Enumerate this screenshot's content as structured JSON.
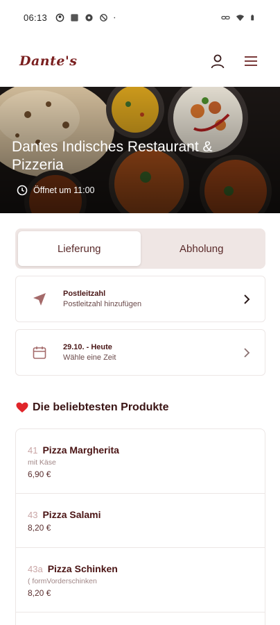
{
  "status_bar": {
    "time": "06:13"
  },
  "header": {
    "logo": "Dante's",
    "icons": [
      "user-icon",
      "menu-icon"
    ]
  },
  "hero": {
    "title": "Dantes Indisches Restaurant & Pizzeria",
    "hours": "Öffnet um 11:00"
  },
  "toggle": {
    "delivery": "Lieferung",
    "pickup": "Abholung",
    "selected": "Lieferung"
  },
  "postcode_card": {
    "title": "Postleitzahl",
    "subtitle": "Postleitzahl hinzufügen"
  },
  "time_card": {
    "title": "29.10. - Heute",
    "subtitle": "Wähle eine Zeit"
  },
  "popular": {
    "title": "Die beliebtesten Produkte",
    "items": [
      {
        "number": "41",
        "name": "Pizza Margherita",
        "description": "mit Käse",
        "price": "6,90 €"
      },
      {
        "number": "43",
        "name": "Pizza Salami",
        "description": "",
        "price": "8,20 €"
      },
      {
        "number": "43a",
        "name": "Pizza Schinken",
        "description": "( formVorderschinken",
        "price": "8,20 €"
      }
    ]
  },
  "colors": {
    "brand": "#7a1f1f",
    "accent_icon": "#a46a6a",
    "toggle_bg": "#efe6e4"
  }
}
